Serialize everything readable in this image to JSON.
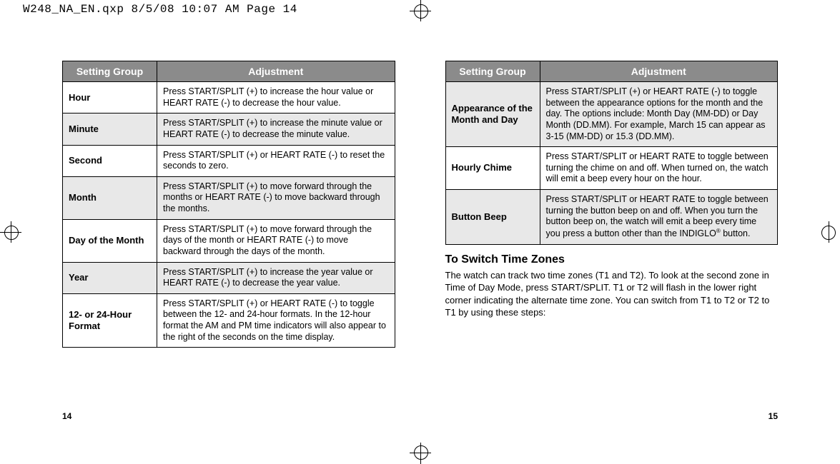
{
  "header_line": "W248_NA_EN.qxp  8/5/08  10:07 AM  Page 14",
  "left_table": {
    "col1": "Setting Group",
    "col2": "Adjustment",
    "rows": [
      {
        "group": "Hour",
        "adj": "Press START/SPLIT (+) to increase the hour value or HEART RATE (-) to decrease the hour value."
      },
      {
        "group": "Minute",
        "adj": "Press START/SPLIT (+) to increase the minute value or HEART RATE (-) to decrease the minute value."
      },
      {
        "group": "Second",
        "adj": "Press START/SPLIT (+) or HEART RATE (-) to reset the seconds to zero."
      },
      {
        "group": "Month",
        "adj": "Press START/SPLIT (+) to move forward through the months or HEART RATE (-) to move backward through the months."
      },
      {
        "group": "Day of the Month",
        "adj": "Press START/SPLIT (+) to move forward through the days of the month or HEART RATE (-) to move backward through the days of the month."
      },
      {
        "group": "Year",
        "adj": "Press START/SPLIT (+) to increase the year value or HEART RATE (-) to decrease the year value."
      },
      {
        "group": "12- or 24-Hour Format",
        "adj": "Press START/SPLIT (+) or HEART RATE (-) to toggle between the 12- and 24-hour formats. In the 12-hour format the AM and PM time indicators will also appear to the right of the seconds on the time display."
      }
    ]
  },
  "right_table": {
    "col1": "Setting Group",
    "col2": "Adjustment",
    "rows": [
      {
        "group": "Appearance of the Month and Day",
        "adj": "Press START/SPLIT (+) or HEART RATE (-) to toggle between the appearance options for the month and the day. The options include: Month Day (MM-DD) or Day Month (DD.MM). For example, March 15 can appear as 3-15 (MM-DD) or 15.3 (DD.MM)."
      },
      {
        "group": "Hourly Chime",
        "adj": "Press START/SPLIT or HEART RATE to toggle between turning the chime on and off. When turned on, the watch will emit a beep every hour on the hour."
      },
      {
        "group": "Button Beep",
        "adj_prefix": "Press START/SPLIT or HEART RATE to toggle between turning the button beep on and off. When you turn the button beep on, the watch will emit a beep every time you press a button other than the INDIGLO",
        "adj_suffix": " button."
      }
    ]
  },
  "section_heading": "To Switch Time Zones",
  "section_body": "The watch can track two time zones (T1 and T2). To look at the second zone in Time of Day Mode, press START/SPLIT. T1 or T2 will flash in the lower right corner indicating the alternate time zone. You can switch from T1 to T2 or T2 to T1 by using these steps:",
  "page_left": "14",
  "page_right": "15"
}
